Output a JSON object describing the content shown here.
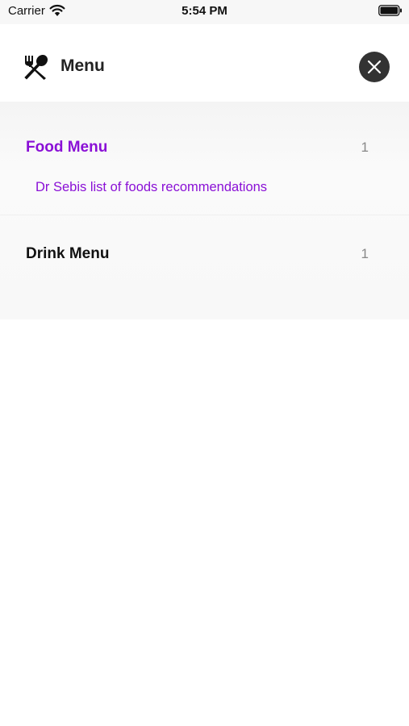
{
  "status_bar": {
    "carrier": "Carrier",
    "time": "5:54 PM",
    "icons": [
      "wifi-icon",
      "battery-icon"
    ]
  },
  "header": {
    "title": "Menu",
    "icon": "fork-spoon-icon",
    "close_icon": "close-icon"
  },
  "menu": {
    "sections": [
      {
        "title": "Food Menu",
        "count": "1",
        "active": true,
        "items": [
          "Dr Sebis list of foods recommendations"
        ]
      },
      {
        "title": "Drink Menu",
        "count": "1",
        "active": false,
        "items": []
      }
    ]
  },
  "colors": {
    "accent": "#8A10D6",
    "text": "#111111",
    "count": "#888888",
    "close_button_bg": "#333333"
  }
}
